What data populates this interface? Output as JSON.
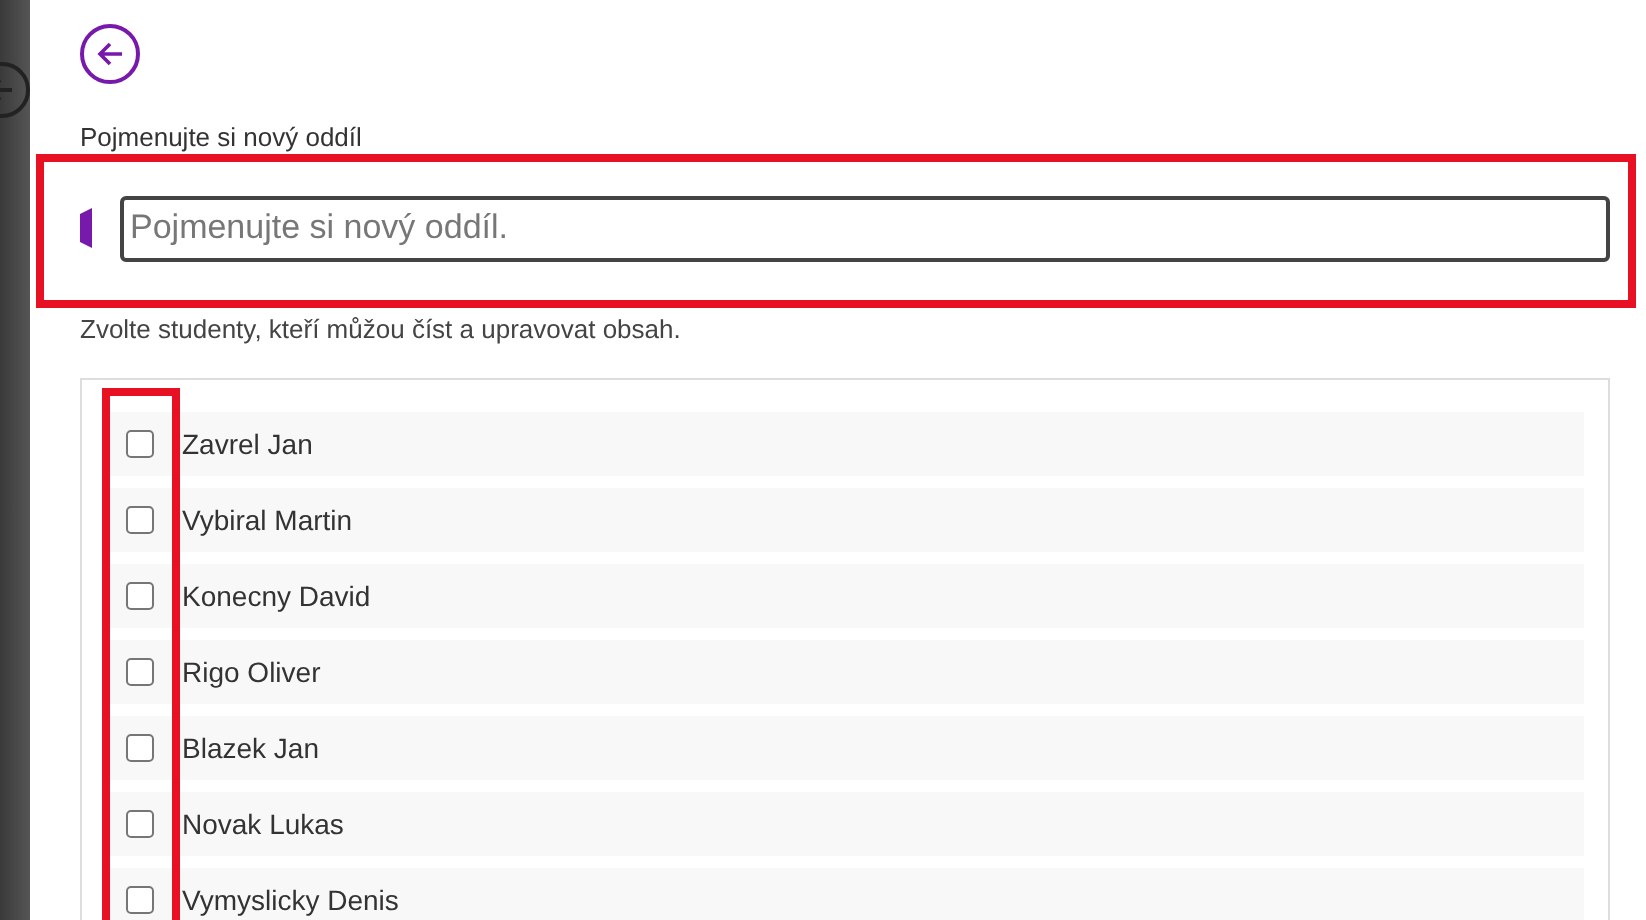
{
  "back_button": {
    "kind": "back"
  },
  "section_name": {
    "label": "Pojmenujte si nový oddíl",
    "placeholder": "Pojmenujte si nový oddíl."
  },
  "students": {
    "instruction": "Zvolte studenty, kteří můžou číst a upravovat obsah.",
    "items": [
      {
        "name": "Zavrel Jan",
        "checked": false
      },
      {
        "name": "Vybiral Martin",
        "checked": false
      },
      {
        "name": "Konecny David",
        "checked": false
      },
      {
        "name": "Rigo Oliver",
        "checked": false
      },
      {
        "name": "Blazek Jan",
        "checked": false
      },
      {
        "name": "Novak Lukas",
        "checked": false
      },
      {
        "name": "Vymyslicky Denis",
        "checked": false
      }
    ]
  },
  "highlights": {
    "name_field": true,
    "checkbox_column": true
  }
}
